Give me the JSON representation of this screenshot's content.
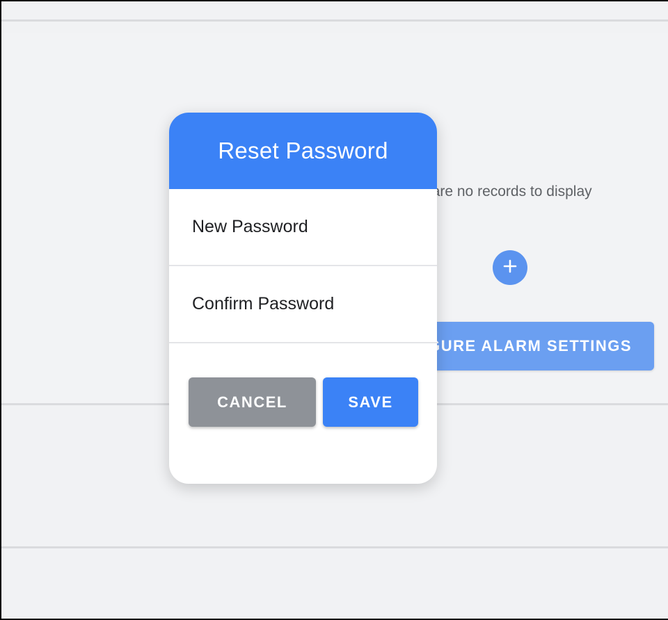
{
  "background": {
    "empty_message": "There are no records to display",
    "add_icon": "plus-icon",
    "alarm_button_label": "CONFIGURE ALARM SETTINGS"
  },
  "dialog": {
    "title": "Reset Password",
    "new_password_placeholder": "New Password",
    "confirm_password_placeholder": "Confirm Password",
    "cancel_label": "CANCEL",
    "save_label": "SAVE"
  },
  "colors": {
    "accent": "#3b82f6",
    "cancel": "#8e9298",
    "page_background": "#f1f2f4"
  }
}
